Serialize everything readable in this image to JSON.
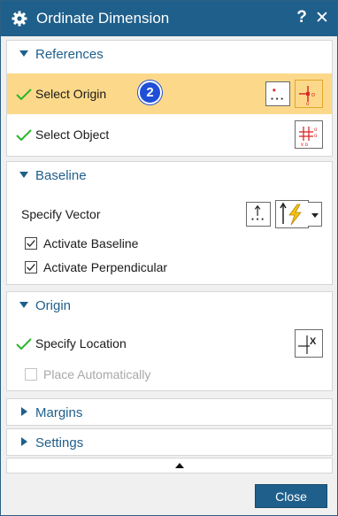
{
  "window": {
    "title": "Ordinate Dimension",
    "help_label": "?",
    "close_label": "✕"
  },
  "references": {
    "header": "References",
    "select_origin": {
      "label": "Select Origin",
      "step_badge": "2",
      "status": "complete"
    },
    "select_object": {
      "label": "Select Object",
      "status": "complete"
    }
  },
  "baseline": {
    "header": "Baseline",
    "specify_vector_label": "Specify Vector",
    "activate_baseline": {
      "label": "Activate Baseline",
      "checked": true
    },
    "activate_perpendicular": {
      "label": "Activate Perpendicular",
      "checked": true
    }
  },
  "origin": {
    "header": "Origin",
    "specify_location": {
      "label": "Specify Location",
      "status": "complete"
    },
    "place_automatically": {
      "label": "Place Automatically",
      "checked": false,
      "enabled": false
    }
  },
  "collapsed_sections": {
    "margins": "Margins",
    "settings": "Settings"
  },
  "footer": {
    "close_button": "Close"
  },
  "colors": {
    "title_bar": "#1f5f8b",
    "highlight": "#fcd98a",
    "check_green": "#2bb52b",
    "badge_blue": "#1f4fd6",
    "icon_red": "#d9292b"
  }
}
